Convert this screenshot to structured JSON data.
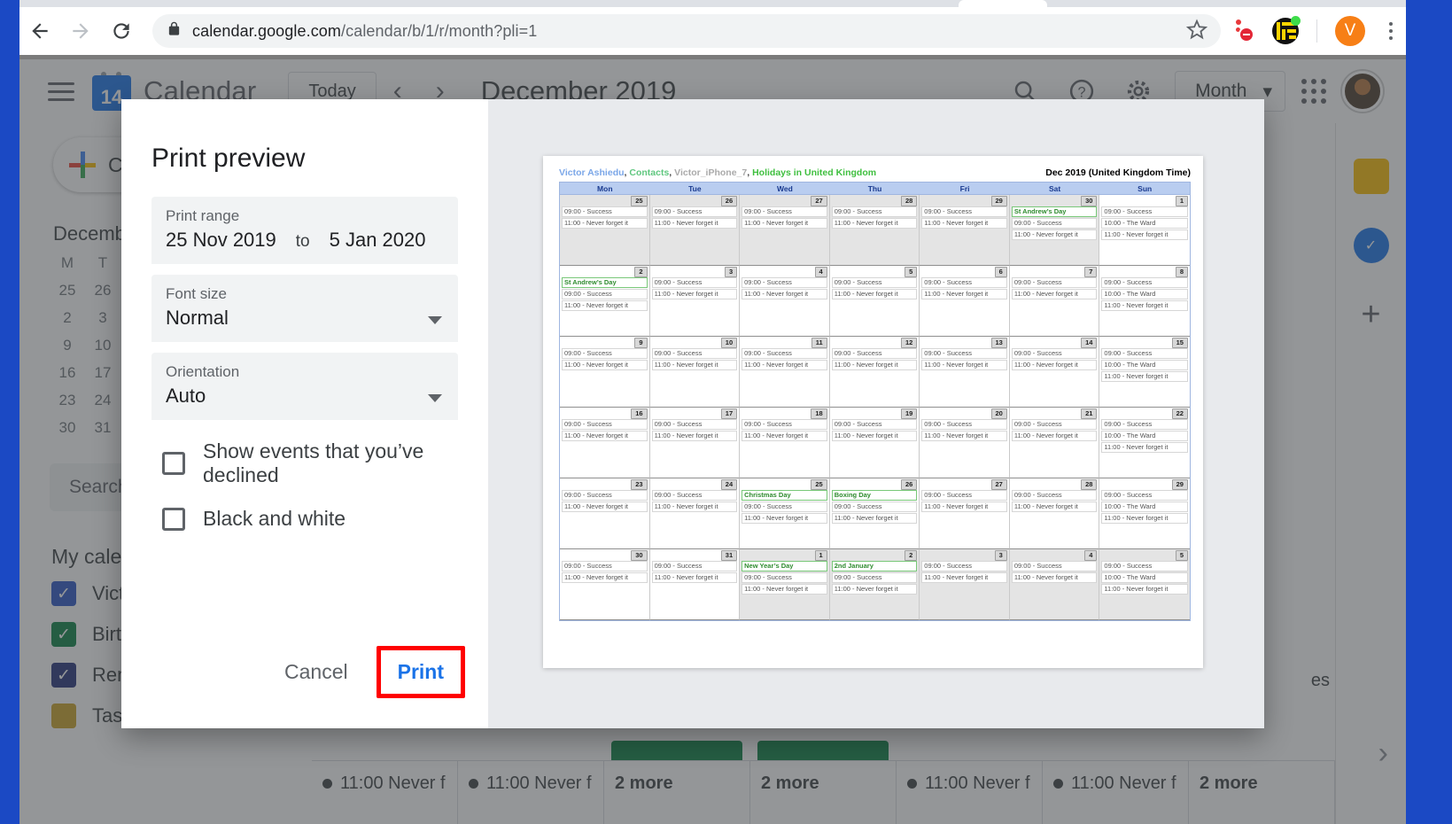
{
  "browser": {
    "back_icon": "back-arrow-icon",
    "forward_icon": "forward-arrow-icon",
    "reload_icon": "reload-icon",
    "lock_icon": "lock-icon",
    "url_domain": "calendar.google.com",
    "url_path": "/calendar/b/1/r/month?pli=1",
    "star_icon": "bookmark-star-icon",
    "extension_1": "blocker-extension-icon",
    "extension_2": "maze-extension-icon",
    "profile_initial": "V",
    "menu_icon": "three-dot-menu-icon"
  },
  "calendar_app": {
    "menu_icon": "hamburger-menu-icon",
    "logo_day": "14",
    "title": "Calendar",
    "today_label": "Today",
    "prev_icon": "chevron-left-icon",
    "next_icon": "chevron-right-icon",
    "month_title": "December 2019",
    "search_icon": "search-icon",
    "help_icon": "help-icon",
    "settings_icon": "gear-icon",
    "view_label": "Month",
    "view_caret": "chevron-down-icon",
    "apps_icon": "apps-grid-icon",
    "avatar": "user-avatar",
    "create_label": "Create",
    "mini_month": "December",
    "mini_dow": [
      "M",
      "T"
    ],
    "mini_weeks": [
      [
        "25",
        "26"
      ],
      [
        "2",
        "3"
      ],
      [
        "9",
        "10"
      ],
      [
        "16",
        "17"
      ],
      [
        "23",
        "24"
      ],
      [
        "30",
        "31"
      ]
    ],
    "search_placeholder": "Search for people",
    "my_calendars_label": "My calendars",
    "calendars": [
      {
        "name": "Victor Ashiedu",
        "color": "#2a56c6",
        "checked": true
      },
      {
        "name": "Birthdays",
        "color": "#0b8043",
        "checked": true
      },
      {
        "name": "Reminders",
        "color": "#25317a",
        "checked": true
      },
      {
        "name": "Tasks",
        "color": "#c9a227",
        "checked": true
      }
    ],
    "rail": [
      "keep-icon",
      "tasks-icon",
      "add-icon"
    ],
    "expand_icon": "chevron-right-icon",
    "bottom_row": [
      {
        "type": "event",
        "text": "11:00 Never f"
      },
      {
        "type": "event",
        "text": "11:00 Never f"
      },
      {
        "type": "more",
        "text": "2 more"
      },
      {
        "type": "more",
        "text": "2 more"
      },
      {
        "type": "event",
        "text": "11:00 Never f"
      },
      {
        "type": "event",
        "text": "11:00 Never f"
      },
      {
        "type": "more",
        "text": "2 more"
      }
    ],
    "overflow_text": "es"
  },
  "dialog": {
    "title": "Print preview",
    "print_range": {
      "label": "Print range",
      "start": "25 Nov 2019",
      "separator": "to",
      "end": "5 Jan 2020"
    },
    "font_size": {
      "label": "Font size",
      "value": "Normal",
      "caret": "chevron-down-icon"
    },
    "orientation": {
      "label": "Orientation",
      "value": "Auto",
      "caret": "chevron-down-icon"
    },
    "checkboxes": [
      {
        "label": "Show events that you’ve declined",
        "checked": false
      },
      {
        "label": "Black and white",
        "checked": false
      }
    ],
    "cancel_label": "Cancel",
    "print_label": "Print",
    "highlight_color": "#ff0000",
    "print_color": "#1a73e8"
  },
  "preview": {
    "calendar_names": [
      {
        "text": "Victor Ashiedu",
        "color": "#7ba7e8"
      },
      {
        "text": "Contacts",
        "color": "#5fc77f"
      },
      {
        "text": "Victor_iPhone_7",
        "color": "#aaaaaa"
      },
      {
        "text": "Holidays in United Kingdom",
        "color": "#3fbf3f"
      }
    ],
    "separator": ", ",
    "period": "Dec 2019 (United Kingdom Time)",
    "day_headers": [
      "Mon",
      "Tue",
      "Wed",
      "Thu",
      "Fri",
      "Sat",
      "Sun"
    ],
    "standard_events": [
      "09:00 - Success",
      "11:00 - Never forget it"
    ],
    "sunday_events": [
      "09:00 - Success",
      "10:00 - The Ward",
      "11:00 - Never forget it"
    ],
    "weeks": [
      {
        "days": [
          {
            "num": "25",
            "shaded": true,
            "events": [
              "09:00 - Success",
              "11:00 - Never forget it"
            ],
            "holidays": []
          },
          {
            "num": "26",
            "shaded": true,
            "events": [
              "09:00 - Success",
              "11:00 - Never forget it"
            ],
            "holidays": []
          },
          {
            "num": "27",
            "shaded": true,
            "events": [
              "09:00 - Success",
              "11:00 - Never forget it"
            ],
            "holidays": []
          },
          {
            "num": "28",
            "shaded": true,
            "events": [
              "09:00 - Success",
              "11:00 - Never forget it"
            ],
            "holidays": []
          },
          {
            "num": "29",
            "shaded": true,
            "events": [
              "09:00 - Success",
              "11:00 - Never forget it"
            ],
            "holidays": []
          },
          {
            "num": "30",
            "shaded": true,
            "events": [
              "09:00 - Success",
              "11:00 - Never forget it"
            ],
            "holidays": [
              "St Andrew’s Day"
            ]
          },
          {
            "num": "1",
            "shaded": false,
            "events": [
              "09:00 - Success",
              "10:00 - The Ward",
              "11:00 - Never forget it"
            ],
            "holidays": []
          }
        ]
      },
      {
        "days": [
          {
            "num": "2",
            "shaded": false,
            "events": [
              "09:00 - Success",
              "11:00 - Never forget it"
            ],
            "holidays": [
              "St Andrew’s Day"
            ]
          },
          {
            "num": "3",
            "shaded": false,
            "events": [
              "09:00 - Success",
              "11:00 - Never forget it"
            ],
            "holidays": []
          },
          {
            "num": "4",
            "shaded": false,
            "events": [
              "09:00 - Success",
              "11:00 - Never forget it"
            ],
            "holidays": []
          },
          {
            "num": "5",
            "shaded": false,
            "events": [
              "09:00 - Success",
              "11:00 - Never forget it"
            ],
            "holidays": []
          },
          {
            "num": "6",
            "shaded": false,
            "events": [
              "09:00 - Success",
              "11:00 - Never forget it"
            ],
            "holidays": []
          },
          {
            "num": "7",
            "shaded": false,
            "events": [
              "09:00 - Success",
              "11:00 - Never forget it"
            ],
            "holidays": []
          },
          {
            "num": "8",
            "shaded": false,
            "events": [
              "09:00 - Success",
              "10:00 - The Ward",
              "11:00 - Never forget it"
            ],
            "holidays": []
          }
        ]
      },
      {
        "days": [
          {
            "num": "9",
            "shaded": false,
            "events": [
              "09:00 - Success",
              "11:00 - Never forget it"
            ],
            "holidays": []
          },
          {
            "num": "10",
            "shaded": false,
            "events": [
              "09:00 - Success",
              "11:00 - Never forget it"
            ],
            "holidays": []
          },
          {
            "num": "11",
            "shaded": false,
            "events": [
              "09:00 - Success",
              "11:00 - Never forget it"
            ],
            "holidays": []
          },
          {
            "num": "12",
            "shaded": false,
            "events": [
              "09:00 - Success",
              "11:00 - Never forget it"
            ],
            "holidays": []
          },
          {
            "num": "13",
            "shaded": false,
            "events": [
              "09:00 - Success",
              "11:00 - Never forget it"
            ],
            "holidays": []
          },
          {
            "num": "14",
            "shaded": false,
            "events": [
              "09:00 - Success",
              "11:00 - Never forget it"
            ],
            "holidays": []
          },
          {
            "num": "15",
            "shaded": false,
            "events": [
              "09:00 - Success",
              "10:00 - The Ward",
              "11:00 - Never forget it"
            ],
            "holidays": []
          }
        ]
      },
      {
        "days": [
          {
            "num": "16",
            "shaded": false,
            "events": [
              "09:00 - Success",
              "11:00 - Never forget it"
            ],
            "holidays": []
          },
          {
            "num": "17",
            "shaded": false,
            "events": [
              "09:00 - Success",
              "11:00 - Never forget it"
            ],
            "holidays": []
          },
          {
            "num": "18",
            "shaded": false,
            "events": [
              "09:00 - Success",
              "11:00 - Never forget it"
            ],
            "holidays": []
          },
          {
            "num": "19",
            "shaded": false,
            "events": [
              "09:00 - Success",
              "11:00 - Never forget it"
            ],
            "holidays": []
          },
          {
            "num": "20",
            "shaded": false,
            "events": [
              "09:00 - Success",
              "11:00 - Never forget it"
            ],
            "holidays": []
          },
          {
            "num": "21",
            "shaded": false,
            "events": [
              "09:00 - Success",
              "11:00 - Never forget it"
            ],
            "holidays": []
          },
          {
            "num": "22",
            "shaded": false,
            "events": [
              "09:00 - Success",
              "10:00 - The Ward",
              "11:00 - Never forget it"
            ],
            "holidays": []
          }
        ]
      },
      {
        "days": [
          {
            "num": "23",
            "shaded": false,
            "events": [
              "09:00 - Success",
              "11:00 - Never forget it"
            ],
            "holidays": []
          },
          {
            "num": "24",
            "shaded": false,
            "events": [
              "09:00 - Success",
              "11:00 - Never forget it"
            ],
            "holidays": []
          },
          {
            "num": "25",
            "shaded": false,
            "events": [
              "09:00 - Success",
              "11:00 - Never forget it"
            ],
            "holidays": [
              "Christmas Day"
            ]
          },
          {
            "num": "26",
            "shaded": false,
            "events": [
              "09:00 - Success",
              "11:00 - Never forget it"
            ],
            "holidays": [
              "Boxing Day"
            ]
          },
          {
            "num": "27",
            "shaded": false,
            "events": [
              "09:00 - Success",
              "11:00 - Never forget it"
            ],
            "holidays": []
          },
          {
            "num": "28",
            "shaded": false,
            "events": [
              "09:00 - Success",
              "11:00 - Never forget it"
            ],
            "holidays": []
          },
          {
            "num": "29",
            "shaded": false,
            "events": [
              "09:00 - Success",
              "10:00 - The Ward",
              "11:00 - Never forget it"
            ],
            "holidays": []
          }
        ]
      },
      {
        "days": [
          {
            "num": "30",
            "shaded": false,
            "events": [
              "09:00 - Success",
              "11:00 - Never forget it"
            ],
            "holidays": []
          },
          {
            "num": "31",
            "shaded": false,
            "events": [
              "09:00 - Success",
              "11:00 - Never forget it"
            ],
            "holidays": []
          },
          {
            "num": "1",
            "shaded": true,
            "events": [
              "09:00 - Success",
              "11:00 - Never forget it"
            ],
            "holidays": [
              "New Year’s Day"
            ]
          },
          {
            "num": "2",
            "shaded": true,
            "events": [
              "09:00 - Success",
              "11:00 - Never forget it"
            ],
            "holidays": [
              "2nd January"
            ]
          },
          {
            "num": "3",
            "shaded": true,
            "events": [
              "09:00 - Success",
              "11:00 - Never forget it"
            ],
            "holidays": []
          },
          {
            "num": "4",
            "shaded": true,
            "events": [
              "09:00 - Success",
              "11:00 - Never forget it"
            ],
            "holidays": []
          },
          {
            "num": "5",
            "shaded": true,
            "events": [
              "09:00 - Success",
              "10:00 - The Ward",
              "11:00 - Never forget it"
            ],
            "holidays": []
          }
        ]
      }
    ]
  }
}
